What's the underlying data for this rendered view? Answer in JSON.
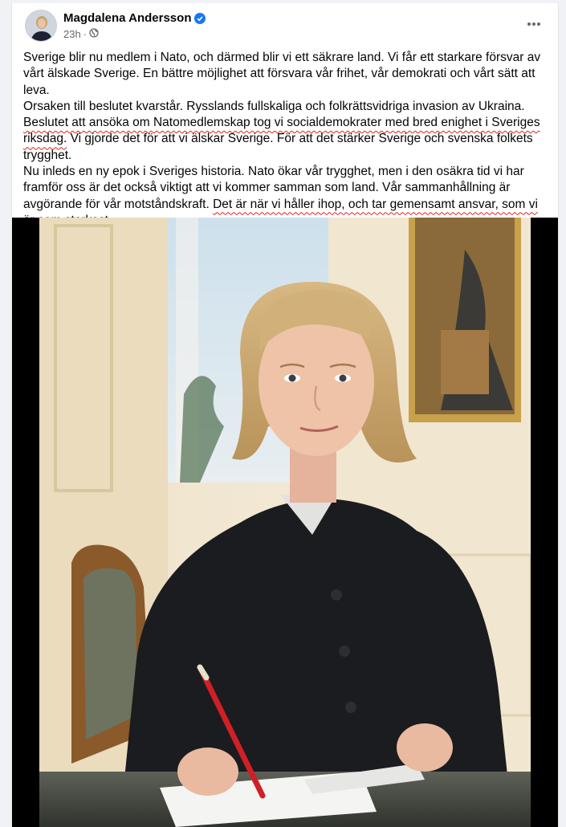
{
  "post": {
    "author": "Magdalena Andersson",
    "time": "23h",
    "paragraphs": [
      [
        {
          "text": "Sverige blir nu medlem i Nato, och därmed blir vi ett säkrare land. Vi får ett starkare försvar av vårt älskade Sverige. En bättre möjlighet att försvara vår frihet, vår demokrati och vårt sätt att leva.",
          "underline": false
        }
      ],
      [
        {
          "text": "Orsaken till beslutet kvarstår. Rysslands fullskaliga och folkrättsvidriga invasion av Ukraina.",
          "underline": false
        }
      ],
      [
        {
          "text": "Beslutet att ansöka om Natomedlemskap tog vi socialdemokrater med bred enighet i Sveriges riksdag.",
          "underline": true
        },
        {
          "text": " Vi gjorde det för att vi älskar Sverige. För att det stärker Sverige och svenska folkets trygghet.",
          "underline": false
        }
      ],
      [
        {
          "text": "Nu inleds en ny epok i Sveriges historia. Nato ökar vår trygghet, men i den osäkra tid vi har framför oss är det också viktigt att vi kommer samman som land. Vår sammanhållning är avgörande för vår motståndskraft. ",
          "underline": false
        },
        {
          "text": "Det är när vi håller ihop, och tar gemensamt ansvar, som vi är som starkast.",
          "underline": true
        }
      ]
    ],
    "colors": {
      "underline": "#e0211c",
      "verified": "#1877f2",
      "meta": "#65676b"
    },
    "icons": {
      "verified": "verified-badge-icon",
      "audience": "globe-icon",
      "menu": "more-options-icon"
    }
  }
}
